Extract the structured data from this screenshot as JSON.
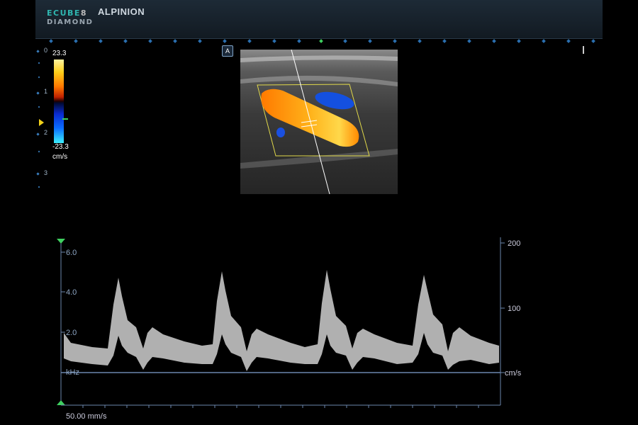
{
  "header": {
    "logo_line1_a": "ECUBE",
    "logo_line1_b": "8",
    "logo_line2": "DIAMOND",
    "brand": "ALPINION"
  },
  "depth_scale": [
    "0",
    "1",
    "2",
    "3"
  ],
  "color_bar": {
    "max": "23.3",
    "min": "-23.3",
    "unit": "cm/s"
  },
  "overlay_button": "A",
  "spectral": {
    "left_ticks": [
      "6.0",
      "4.0",
      "2.0"
    ],
    "left_unit": "kHz",
    "right_ticks": [
      "200",
      "100"
    ],
    "right_unit": "cm/s",
    "sweep_speed": "50.00 mm/s"
  },
  "colors": {
    "axis": "#6a86ad",
    "header_bg": "#18232e",
    "marker_green": "#3fd060",
    "focus_yellow": "#f2d21a"
  }
}
